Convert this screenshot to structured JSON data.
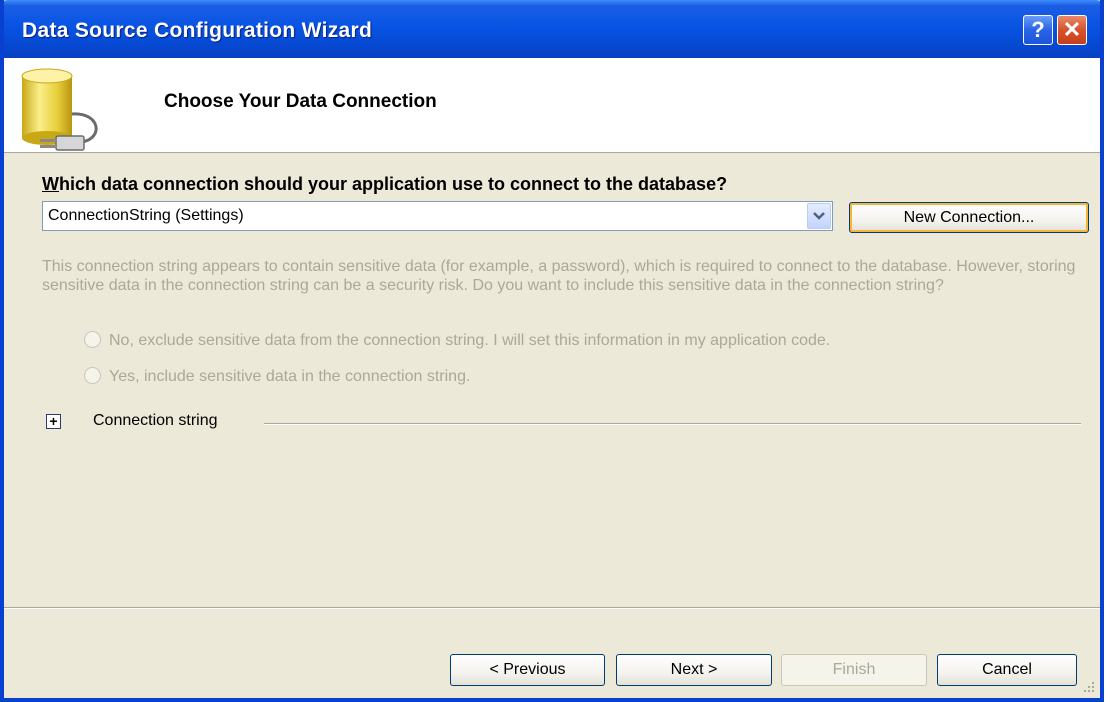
{
  "window": {
    "title": "Data Source Configuration Wizard",
    "help_glyph": "?",
    "close_glyph": "✕"
  },
  "header": {
    "title": "Choose Your Data Connection",
    "icon": "database-plug-icon"
  },
  "main": {
    "question": "Which data connection should your application use to connect to the database?",
    "connection_select": {
      "value": "ConnectionString (Settings)"
    },
    "new_connection_button": "New Connection...",
    "sensitive_info": "This connection string appears to contain sensitive data (for example, a password), which is required to connect to the database. However, storing sensitive data in the connection string can be a security risk. Do you want to include this sensitive data in the connection string?",
    "radio_options": [
      "No, exclude sensitive data from the connection string. I will set this information in my application code.",
      "Yes, include sensitive data in the connection string."
    ],
    "connection_string_label": "Connection string",
    "expander_glyph": "+"
  },
  "footer": {
    "previous_label": "< Previous",
    "next_label": "Next >",
    "finish_label": "Finish",
    "cancel_label": "Cancel"
  },
  "colors": {
    "title_bar": "#0854e4",
    "window_bg": "#ece9d8",
    "disabled_text": "#aca899",
    "focus_accent": "#f8b43c"
  }
}
